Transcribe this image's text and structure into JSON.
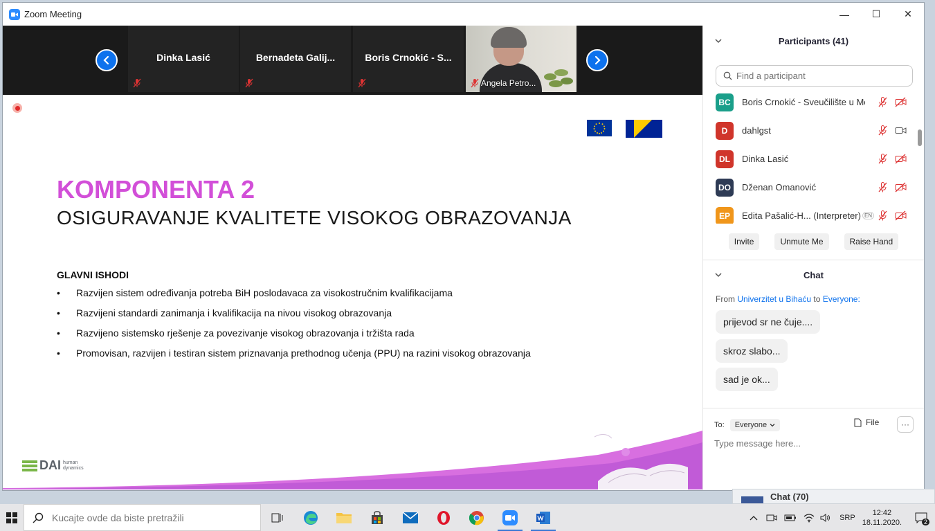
{
  "window": {
    "title": "Zoom Meeting",
    "minimize": "—",
    "maximize": "☐",
    "close": "✕"
  },
  "video_strip": {
    "tiles": [
      {
        "name": "Dinka Lasić"
      },
      {
        "name": "Bernadeta Galij..."
      },
      {
        "name": "Boris Crnokić - S..."
      },
      {
        "name": "Angela Petro..."
      }
    ]
  },
  "slide": {
    "title": "KOMPONENTA 2",
    "subtitle": "OSIGURAVANJE KVALITETE VISOKOG OBRAZOVANJA",
    "outcomes_heading": "GLAVNI ISHODI",
    "outcomes": [
      "Razvijen sistem određivanja potreba BiH poslodavaca za visokostručnim kvalifikacijama",
      "Razvijeni standardi zanimanja i kvalifikacija na nivou visokog obrazovanja",
      "Razvijeno sistemsko rješenje za povezivanje visokog obrazovanja i tržišta rada",
      "Promovisan, razvijen i testiran sistem priznavanja prethodnog učenja (PPU) na razini visokog obrazovanja"
    ],
    "bullet": "•",
    "logo": {
      "brand": "DAI",
      "tag_line1": "human",
      "tag_line2": "dynamics"
    },
    "colors": {
      "title": "#d24fd8",
      "logo_green": "#7ab648"
    }
  },
  "participants": {
    "heading": "Participants (41)",
    "search_placeholder": "Find a participant",
    "list": [
      {
        "initials": "BC",
        "name": "Boris Crnokić - Sveučilište u Mo...",
        "color": "#1a9f8a",
        "video": "off"
      },
      {
        "initials": "D",
        "name": "dahlgst",
        "color": "#d0352b",
        "video": "on"
      },
      {
        "initials": "DL",
        "name": "Dinka Lasić",
        "color": "#d0352b",
        "video": "off"
      },
      {
        "initials": "DO",
        "name": "Dženan Omanović",
        "color": "#2e3b55",
        "video": "off"
      },
      {
        "initials": "EP",
        "name": "Edita Pašalić-H...  (Interpreter)",
        "lang": "EN",
        "color": "#f0961b",
        "video": "off"
      }
    ],
    "buttons": {
      "invite": "Invite",
      "unmute": "Unmute Me",
      "raise": "Raise Hand"
    }
  },
  "chat": {
    "heading": "Chat",
    "from_prefix": "From",
    "from_name": "Univerzitet u Bihaću",
    "to_word": "to",
    "to_name": "Everyone:",
    "messages": [
      "prijevod sr ne čuje....",
      "skroz slabo...",
      "sad je ok..."
    ],
    "to_label": "To:",
    "recipient": "Everyone",
    "file_label": "File",
    "more_label": "···",
    "input_placeholder": "Type message here..."
  },
  "background_window": {
    "label": "Chat (70)"
  },
  "taskbar": {
    "search_placeholder": "Kucajte ovde da biste pretražili",
    "language": "SRP",
    "time": "12:42",
    "date": "18.11.2020.",
    "notifications": "2"
  }
}
